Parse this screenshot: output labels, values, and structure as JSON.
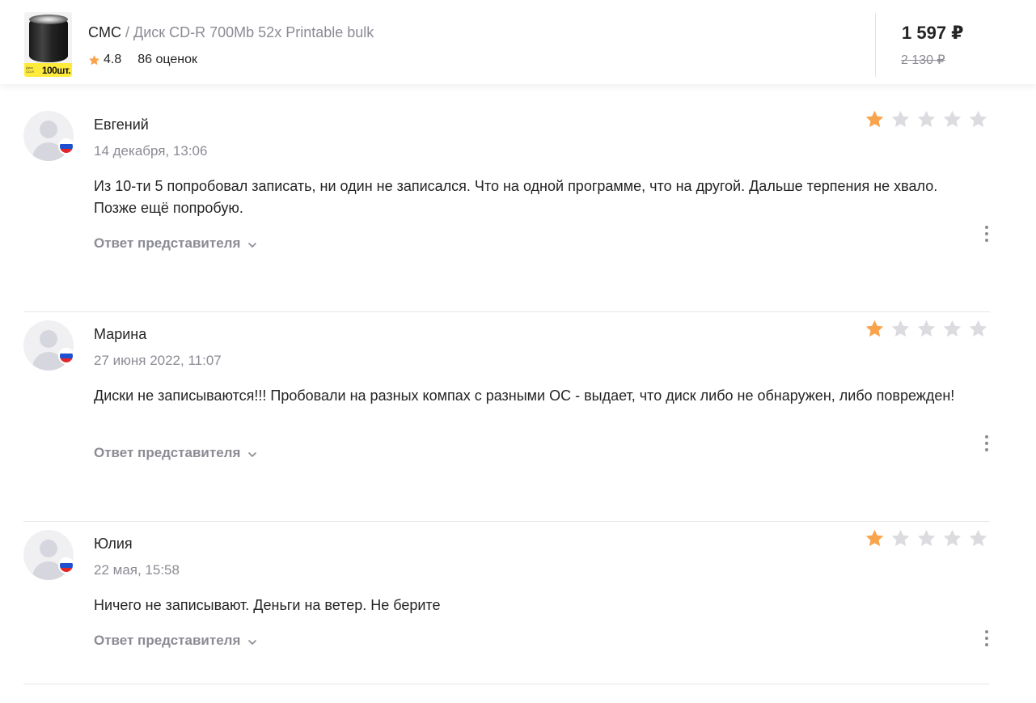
{
  "header": {
    "thumb_badge_small": "Диск CD-R",
    "thumb_badge_big": "100шт.",
    "brand": "CMC",
    "separator": " / ",
    "product_name": "Диск CD-R 700Mb 52x Printable bulk",
    "rating": "4.8",
    "rating_count": "86 оценок",
    "price_current": "1 597 ₽",
    "price_old": "2 130 ₽"
  },
  "colors": {
    "star_active": "#f9a44d",
    "star_inactive": "#dcdce0",
    "muted_text": "#8b8b94",
    "primary_text": "#242424"
  },
  "reviews": [
    {
      "name": "Евгений",
      "date": "14 декабря, 13:06",
      "text": "Из 10-ти 5 попробовал записать, ни один не записался. Что на одной программе, что на другой. Дальше терпения не хвало. Позже ещё попробую.",
      "stars": 1,
      "reply_label": "Ответ представителя"
    },
    {
      "name": "Марина",
      "date": "27 июня 2022, 11:07",
      "text": "Диски не записываются!!! Пробовали на разных компах с разными ОС - выдает, что диск либо не обнаружен, либо поврежден!",
      "stars": 1,
      "reply_label": "Ответ представителя"
    },
    {
      "name": "Юлия",
      "date": "22 мая, 15:58",
      "text": "Ничего не записывают. Деньги на ветер. Не берите",
      "stars": 1,
      "reply_label": "Ответ представителя"
    }
  ]
}
